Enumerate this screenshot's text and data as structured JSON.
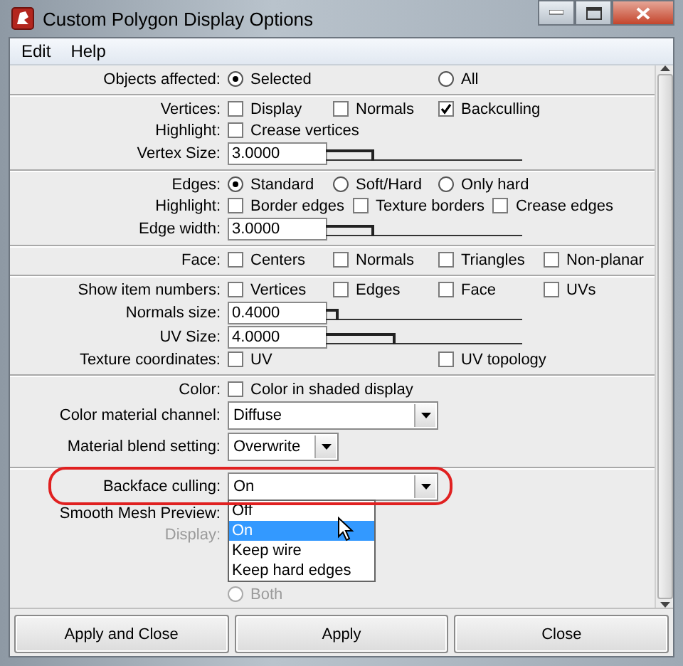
{
  "window": {
    "title": "Custom Polygon Display Options"
  },
  "menu": [
    {
      "label": "Edit"
    },
    {
      "label": "Help"
    }
  ],
  "sections": [
    {
      "rows": [
        {
          "kind": "options",
          "label": "Objects affected:",
          "controls": [
            {
              "kind": "radio",
              "label": "Selected",
              "selected": true
            },
            {
              "kind": "radio",
              "label": "All",
              "selected": false
            }
          ]
        }
      ]
    },
    {
      "rows": [
        {
          "kind": "options",
          "label": "Vertices:",
          "controls": [
            {
              "kind": "check",
              "label": "Display",
              "checked": false
            },
            {
              "kind": "check",
              "label": "Normals",
              "checked": false
            },
            {
              "kind": "check",
              "label": "Backculling",
              "checked": true
            }
          ]
        },
        {
          "kind": "options",
          "label": "Highlight:",
          "controls": [
            {
              "kind": "check",
              "label": "Crease vertices",
              "checked": false
            }
          ]
        },
        {
          "kind": "field",
          "label": "Vertex Size:",
          "value": "3.0000",
          "level": 0.24
        }
      ]
    },
    {
      "rows": [
        {
          "kind": "options",
          "label": "Edges:",
          "controls": [
            {
              "kind": "radio",
              "label": "Standard",
              "selected": true
            },
            {
              "kind": "radio",
              "label": "Soft/Hard",
              "selected": false
            },
            {
              "kind": "radio",
              "label": "Only hard",
              "selected": false
            }
          ]
        },
        {
          "kind": "options",
          "label": "Highlight:",
          "controls": [
            {
              "kind": "check",
              "label": "Border edges",
              "checked": false
            },
            {
              "kind": "check",
              "label": "Texture borders",
              "checked": false
            },
            {
              "kind": "check",
              "label": "Crease edges",
              "checked": false
            }
          ]
        },
        {
          "kind": "field",
          "label": "Edge width:",
          "value": "3.0000",
          "level": 0.24
        }
      ]
    },
    {
      "rows": [
        {
          "kind": "options",
          "label": "Face:",
          "controls": [
            {
              "kind": "check",
              "label": "Centers",
              "checked": false
            },
            {
              "kind": "check",
              "label": "Normals",
              "checked": false
            },
            {
              "kind": "check",
              "label": "Triangles",
              "checked": false
            },
            {
              "kind": "check",
              "label": "Non-planar",
              "checked": false
            }
          ]
        }
      ]
    },
    {
      "rows": [
        {
          "kind": "options",
          "label": "Show item numbers:",
          "controls": [
            {
              "kind": "check",
              "label": "Vertices",
              "checked": false
            },
            {
              "kind": "check",
              "label": "Edges",
              "checked": false
            },
            {
              "kind": "check",
              "label": "Face",
              "checked": false
            },
            {
              "kind": "check",
              "label": "UVs",
              "checked": false
            }
          ]
        },
        {
          "kind": "field",
          "label": "Normals size:",
          "value": "0.4000",
          "level": 0.06
        },
        {
          "kind": "field",
          "label": "UV Size:",
          "value": "4.0000",
          "level": 0.35
        },
        {
          "kind": "options",
          "label": "Texture coordinates:",
          "controls": [
            {
              "kind": "check",
              "label": "UV",
              "checked": false
            },
            {
              "kind": "check",
              "label": "UV topology",
              "checked": false
            }
          ]
        }
      ]
    },
    {
      "rows": [
        {
          "kind": "options",
          "label": "Color:",
          "controls": [
            {
              "kind": "check",
              "label": "Color in shaded display",
              "checked": false
            }
          ]
        },
        {
          "kind": "combo",
          "label": "Color material channel:",
          "value": "Diffuse"
        },
        {
          "kind": "combo",
          "label": "Material blend setting:",
          "value": "Overwrite"
        }
      ]
    },
    {
      "rows": [
        {
          "kind": "combo",
          "label": "Backface culling:",
          "value": "On",
          "expanded": true,
          "highlighted": true,
          "options": [
            {
              "label": "Off",
              "selected": false
            },
            {
              "label": "On",
              "selected": true
            },
            {
              "label": "Keep wire",
              "selected": false
            },
            {
              "label": "Keep hard edges",
              "selected": false
            }
          ]
        },
        {
          "kind": "label",
          "label": "Smooth Mesh Preview:",
          "disabled": false
        },
        {
          "kind": "label",
          "label": "Display:",
          "disabled": true
        },
        {
          "kind": "bottom",
          "controls": [
            {
              "kind": "radio",
              "label": "Both",
              "selected": false,
              "disabled": true
            }
          ]
        }
      ]
    }
  ],
  "buttons": [
    {
      "label": "Apply and Close"
    },
    {
      "label": "Apply"
    },
    {
      "label": "Close"
    }
  ]
}
